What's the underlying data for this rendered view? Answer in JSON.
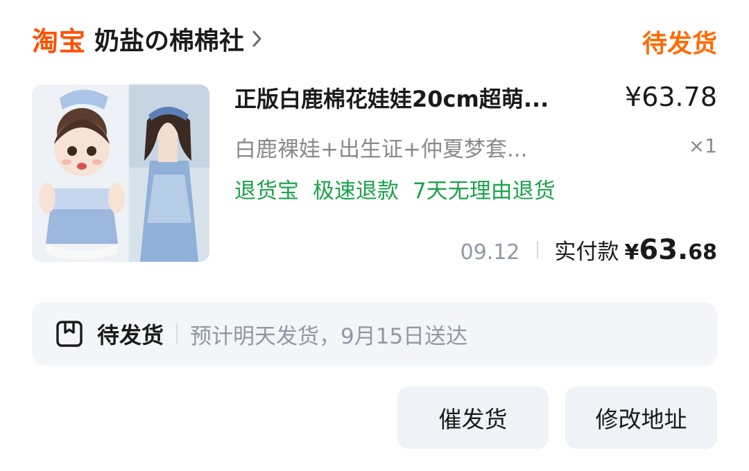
{
  "header": {
    "platform": "淘宝",
    "shop_name": "奶盐の棉棉社",
    "order_status": "待发货"
  },
  "item": {
    "title": "正版白鹿棉花娃娃20cm超萌...",
    "price": "¥63.78",
    "spec": "白鹿裸娃+出生证+仲夏梦套...",
    "quantity": "×1",
    "tags": [
      "退货宝",
      "极速退款",
      "7天无理由退货"
    ]
  },
  "payment": {
    "date": "09.12",
    "label": "实付款",
    "currency": "¥",
    "amount_int": "63.",
    "amount_dec": "68"
  },
  "logistics": {
    "status": "待发货",
    "text": "预计明天发货，9月15日送达"
  },
  "actions": {
    "urge_label": "催发货",
    "change_address_label": "修改地址"
  },
  "colors": {
    "brand": "#ff5000",
    "status": "#ff6a00",
    "tag_green": "#1aa34a",
    "muted": "#8f98a3"
  }
}
